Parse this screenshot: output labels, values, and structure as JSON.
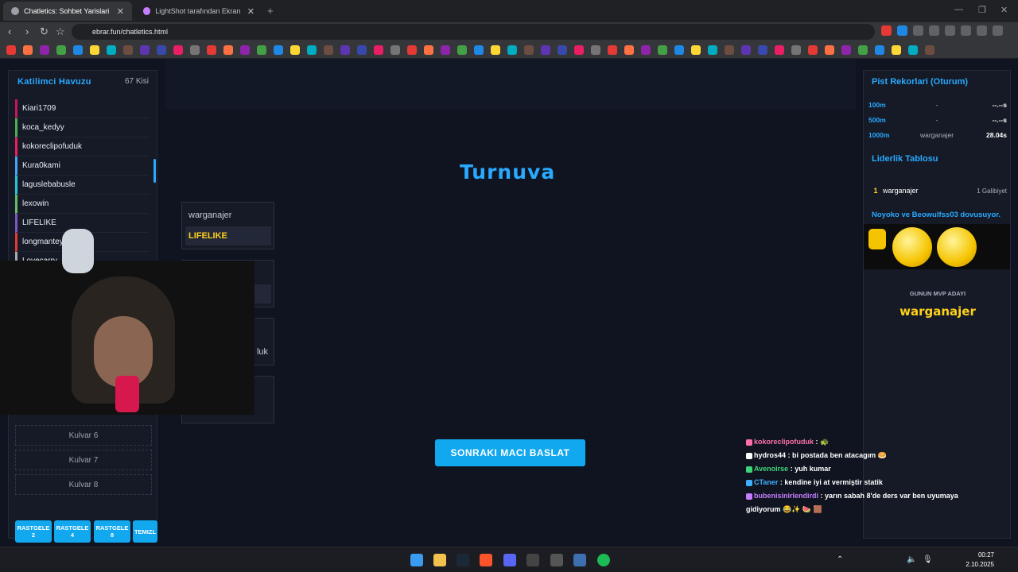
{
  "browser": {
    "tabs": [
      {
        "title": "Chatletics: Sohbet Yarislari",
        "active": true
      },
      {
        "title": "LightShot tarafından Ekran Görüntüsü",
        "active": false
      }
    ],
    "url": "ebrar.fun/chatletics.html"
  },
  "left_panel": {
    "title": "Katilimci Havuzu",
    "count": "67 Kisi",
    "participants": [
      {
        "name": "Kiari1709",
        "color": "#c2185b"
      },
      {
        "name": "koca_kedyy",
        "color": "#4caf50"
      },
      {
        "name": "kokoreclipofuduk",
        "color": "#e91e63"
      },
      {
        "name": "Kura0kami",
        "color": "#42a5f5"
      },
      {
        "name": "laguslebabusle",
        "color": "#26c6da"
      },
      {
        "name": "lexowin",
        "color": "#66bb6a"
      },
      {
        "name": "LIFELIKE",
        "color": "#7e57c2"
      },
      {
        "name": "longmanteyy",
        "color": "#e53935"
      },
      {
        "name": "Lovecarry",
        "color": "#aaaaaa"
      }
    ],
    "lanes": [
      "Kulvar 6",
      "Kulvar 7",
      "Kulvar 8"
    ],
    "random_buttons": [
      {
        "l1": "RASTGELE",
        "l2": "2"
      },
      {
        "l1": "RASTGELE",
        "l2": "4"
      },
      {
        "l1": "RASTGELE",
        "l2": "8"
      },
      {
        "l1": "TEMIZL",
        "l2": ""
      }
    ]
  },
  "center": {
    "title": "Turnuva",
    "match1": {
      "p1": "warganajer",
      "p2": "LIFELIKE"
    },
    "match3_partial": "luk",
    "start_button": "SONRAKI MACI BASLAT"
  },
  "right_panel": {
    "records_title": "Pist Rekorlari (Oturum)",
    "records": [
      {
        "distance": "100m",
        "name": "-",
        "time": "--.--s"
      },
      {
        "distance": "500m",
        "name": "-",
        "time": "--.--s"
      },
      {
        "distance": "1000m",
        "name": "warganajer",
        "time": "28.04s"
      }
    ],
    "leaderboard_title": "Liderlik Tablosu",
    "leaderboard": [
      {
        "rank": "1",
        "name": "warganajer",
        "wins": "1 Galibiyet"
      }
    ],
    "fight_text": "Noyoko ve Beowulfss03 dovusuyor.",
    "mvp_label": "GUNUN MVP ADAYI",
    "mvp_name": "warganajer"
  },
  "chat": [
    {
      "user": "kokoreclipofuduk",
      "color": "#ff6fa8",
      "msg": ": 🐢"
    },
    {
      "user": "hydros44",
      "color": "#ffffff",
      "msg": ": bi postada ben atacagım 🥯"
    },
    {
      "user": "Avenoirse",
      "color": "#3fd47a",
      "msg": ": yuh kumar"
    },
    {
      "user": "CTaner",
      "color": "#3fb0ff",
      "msg": ": kendine iyi at vermiştir statik"
    },
    {
      "user": "bubenisinirlendirdi",
      "color": "#c77dff",
      "msg": ": yarın sabah 8'de ders var ben uyumaya"
    },
    {
      "user": "",
      "color": "#ffffff",
      "msg": "gidiyorum 😂✨ 🍉 🟫"
    }
  ],
  "taskbar": {
    "time": "00:27",
    "date": "2.10.2025"
  }
}
